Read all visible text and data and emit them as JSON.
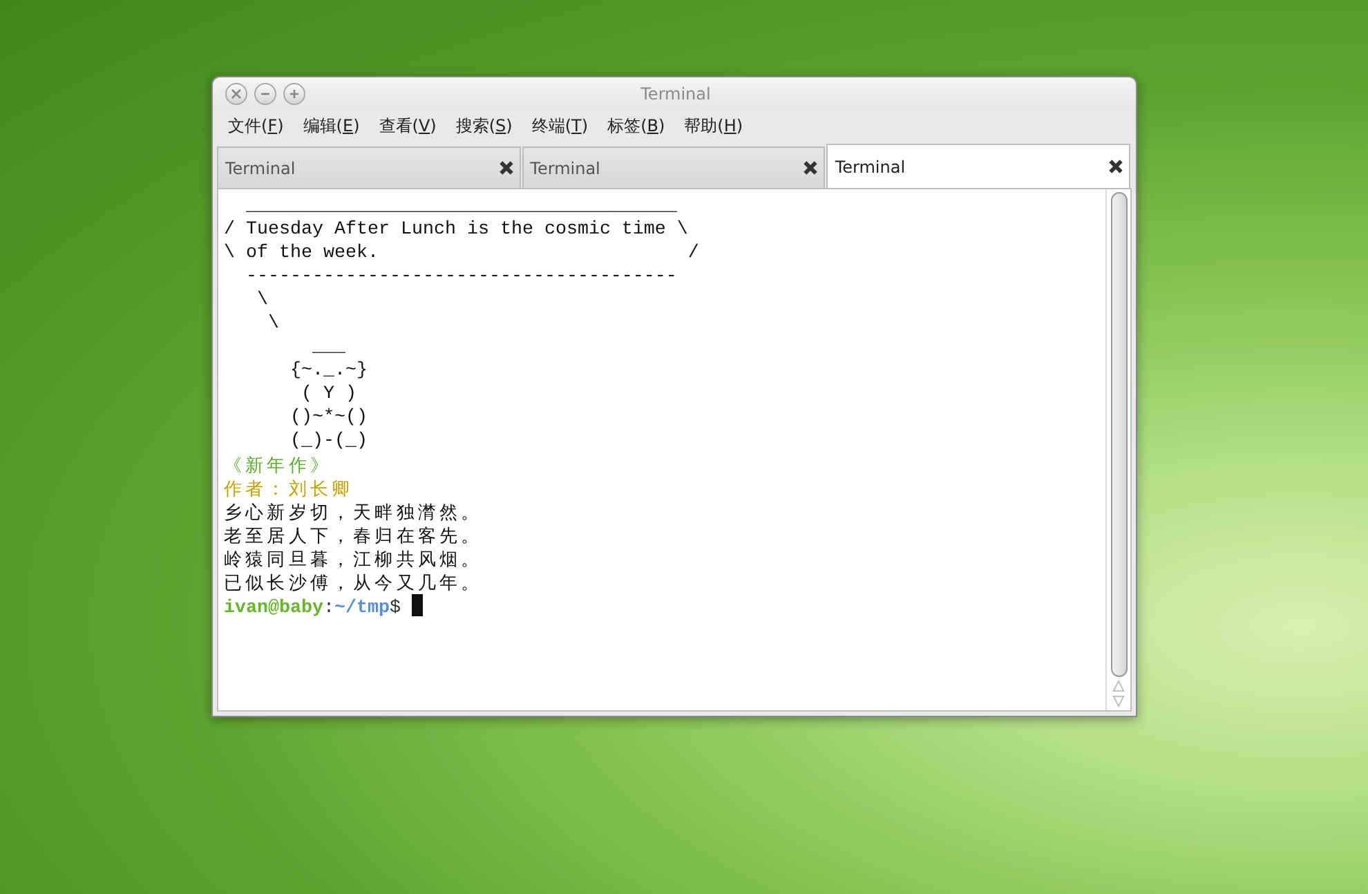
{
  "window": {
    "title": "Terminal"
  },
  "menu": [
    {
      "before": "文件(",
      "key": "F",
      "after": ")"
    },
    {
      "before": "编辑(",
      "key": "E",
      "after": ")"
    },
    {
      "before": "查看(",
      "key": "V",
      "after": ")"
    },
    {
      "before": "搜索(",
      "key": "S",
      "after": ")"
    },
    {
      "before": "终端(",
      "key": "T",
      "after": ")"
    },
    {
      "before": "标签(",
      "key": "B",
      "after": ")"
    },
    {
      "before": "帮助(",
      "key": "H",
      "after": ")"
    }
  ],
  "tabs": [
    {
      "label": "Terminal",
      "selected": false
    },
    {
      "label": "Terminal",
      "selected": false
    },
    {
      "label": "Terminal",
      "selected": true
    }
  ],
  "terminal": {
    "lines": [
      {
        "kind": "plain",
        "text": "  _______________________________________"
      },
      {
        "kind": "plain",
        "text": "/ Tuesday After Lunch is the cosmic time \\"
      },
      {
        "kind": "plain",
        "text": "\\ of the week.                            /"
      },
      {
        "kind": "plain",
        "text": "  ---------------------------------------"
      },
      {
        "kind": "plain",
        "text": "   \\"
      },
      {
        "kind": "plain",
        "text": "    \\"
      },
      {
        "kind": "plain",
        "text": "        ___"
      },
      {
        "kind": "plain",
        "text": "      {~._.~}"
      },
      {
        "kind": "plain",
        "text": "       ( Y )"
      },
      {
        "kind": "plain",
        "text": "      ()~*~()"
      },
      {
        "kind": "plain",
        "text": "      (_)-(_)"
      },
      {
        "kind": "title",
        "text": "《新年作》"
      },
      {
        "kind": "author",
        "text": "作者：刘长卿"
      },
      {
        "kind": "verse",
        "text": "乡心新岁切，天畔独潸然。"
      },
      {
        "kind": "verse",
        "text": "老至居人下，春归在客先。"
      },
      {
        "kind": "verse",
        "text": "岭猿同旦暮，江柳共风烟。"
      },
      {
        "kind": "verse",
        "text": "已似长沙傅，从今又几年。"
      }
    ],
    "prompt": {
      "user_host": "ivan@baby",
      "separator": ":",
      "path": "~/tmp",
      "symbol": "$"
    }
  }
}
